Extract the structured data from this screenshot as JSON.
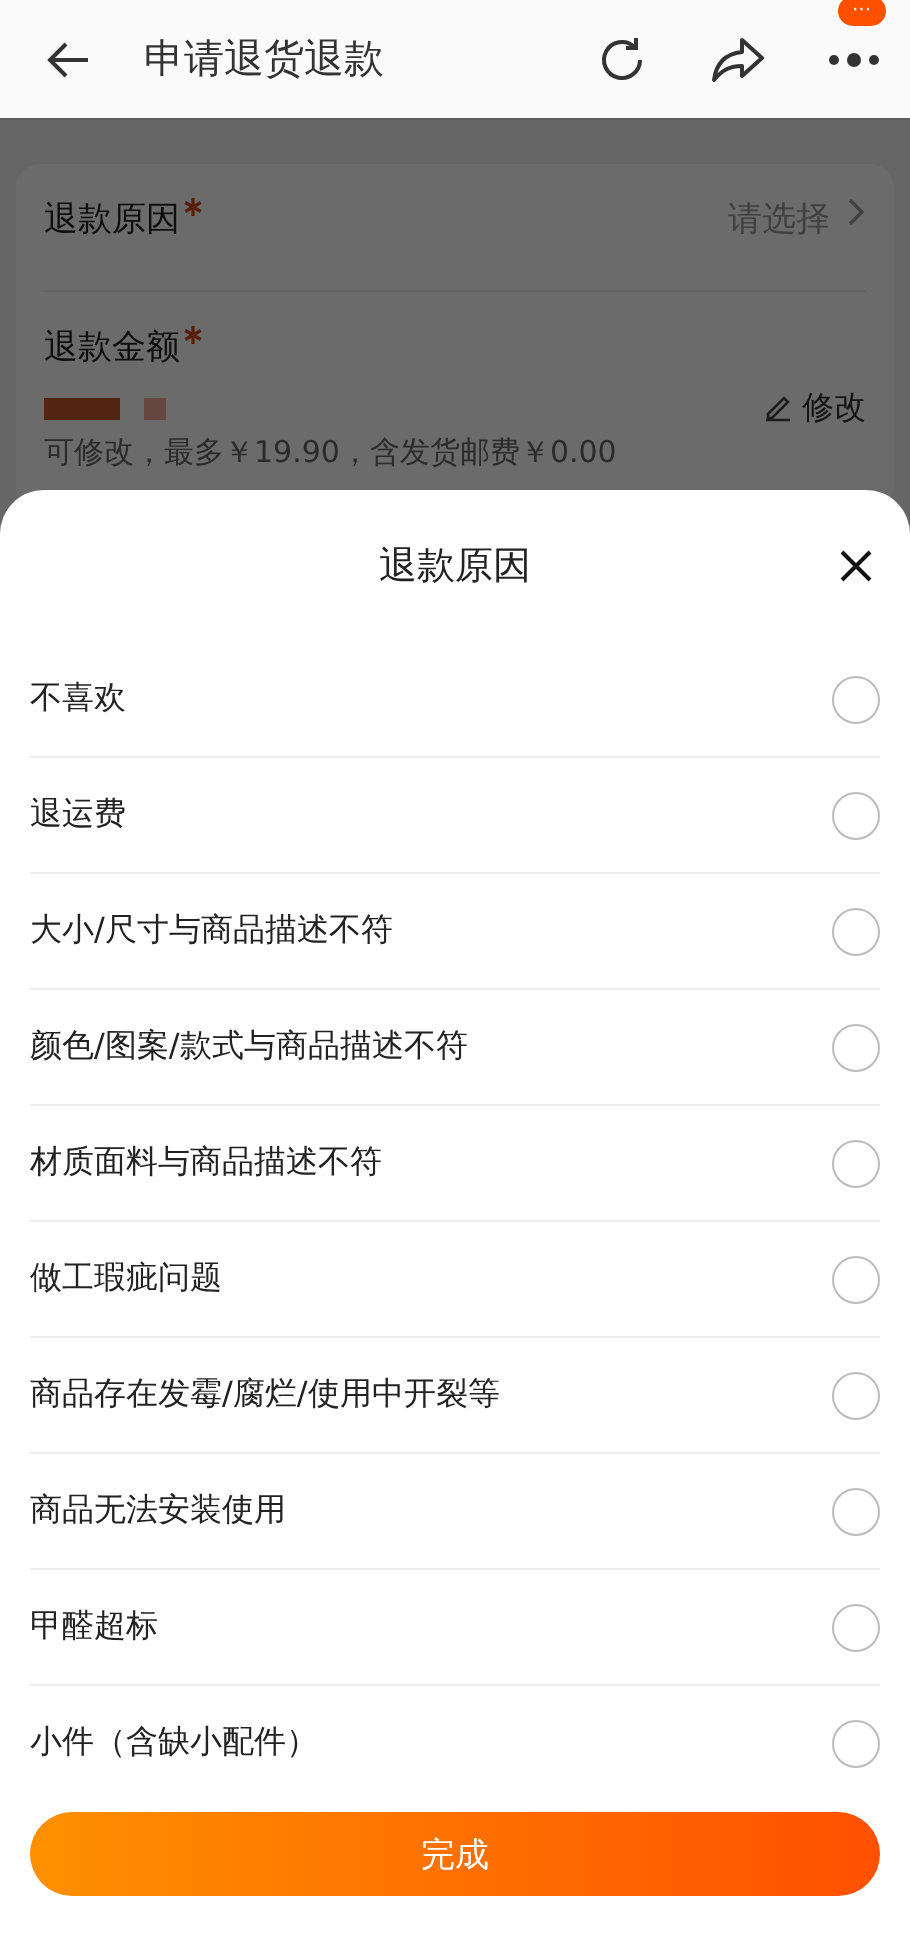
{
  "top_bar": {
    "title": "申请退货退款",
    "badge": "···"
  },
  "form": {
    "reason_label": "退款原因",
    "reason_required": true,
    "reason_value": "请选择",
    "amount_label": "退款金额",
    "amount_required": true,
    "edit_label": "修改",
    "amount_note": "可修改，最多￥19.90，含发货邮费￥0.00"
  },
  "sheet": {
    "title": "退款原因",
    "options": [
      {
        "label": "不喜欢",
        "selected": false
      },
      {
        "label": "退运费",
        "selected": false
      },
      {
        "label": "大小/尺寸与商品描述不符",
        "selected": false
      },
      {
        "label": "颜色/图案/款式与商品描述不符",
        "selected": false
      },
      {
        "label": "材质面料与商品描述不符",
        "selected": false
      },
      {
        "label": "做工瑕疵问题",
        "selected": false
      },
      {
        "label": "商品存在发霉/腐烂/使用中开裂等",
        "selected": false
      },
      {
        "label": "商品无法安装使用",
        "selected": false
      },
      {
        "label": "甲醛超标",
        "selected": false
      },
      {
        "label": "小件（含缺小配件）",
        "selected": false
      }
    ],
    "done_button": "完成"
  }
}
